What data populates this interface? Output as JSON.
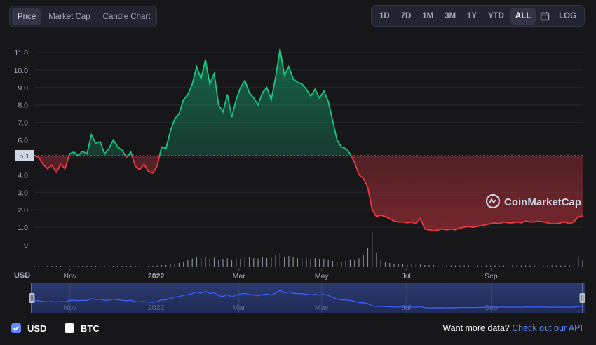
{
  "tabs": [
    {
      "label": "Price",
      "active": true
    },
    {
      "label": "Market Cap",
      "active": false
    },
    {
      "label": "Candle Chart",
      "active": false
    }
  ],
  "ranges": [
    {
      "label": "1D",
      "active": false
    },
    {
      "label": "7D",
      "active": false
    },
    {
      "label": "1M",
      "active": false
    },
    {
      "label": "3M",
      "active": false
    },
    {
      "label": "1Y",
      "active": false
    },
    {
      "label": "YTD",
      "active": false
    },
    {
      "label": "ALL",
      "active": true
    }
  ],
  "log_label": "LOG",
  "currency_label": "USD",
  "brand": "CoinMarketCap",
  "footer": {
    "usd_label": "USD",
    "btc_label": "BTC",
    "usd_checked": true,
    "btc_checked": false,
    "prompt": "Want more data?",
    "link": "Check out our API"
  },
  "colors": {
    "up": "#16c784",
    "down": "#ea3943",
    "accent": "#6188ff",
    "navigator_line": "#3861fb"
  },
  "chart_data": {
    "type": "line",
    "baseline_value": 5.1,
    "baseline_label": "5.1",
    "y_ticks": [
      "11.0",
      "10.0",
      "9.0",
      "8.0",
      "7.0",
      "6.0",
      "5.0",
      "4.0",
      "3.0",
      "2.0",
      "1.0",
      "0"
    ],
    "y_tick_values": [
      11,
      10,
      9,
      8,
      7,
      6,
      5,
      4,
      3,
      2,
      1,
      0
    ],
    "ylim": [
      0,
      11.6
    ],
    "x_ticks": [
      {
        "label": "Nov",
        "t": 0.065
      },
      {
        "label": "2022",
        "t": 0.222
      },
      {
        "label": "Mar",
        "t": 0.373
      },
      {
        "label": "May",
        "t": 0.524
      },
      {
        "label": "Jul",
        "t": 0.678
      },
      {
        "label": "Sep",
        "t": 0.833
      }
    ],
    "series": [
      {
        "values": [
          5.1,
          5.0,
          4.6,
          4.35,
          4.55,
          4.15,
          4.6,
          4.35,
          5.2,
          5.3,
          5.1,
          5.35,
          5.2,
          6.3,
          5.8,
          5.9,
          5.2,
          5.5,
          6.0,
          5.6,
          5.4,
          5.0,
          5.3,
          4.5,
          4.3,
          4.6,
          4.2,
          4.1,
          4.5,
          5.6,
          5.5,
          6.5,
          7.2,
          7.5,
          8.3,
          8.6,
          9.2,
          10.2,
          9.5,
          10.6,
          9.2,
          9.8,
          8.0,
          7.6,
          8.6,
          7.3,
          8.3,
          9.0,
          9.4,
          8.7,
          8.4,
          8.0,
          8.7,
          9.0,
          8.3,
          9.6,
          11.2,
          9.7,
          10.2,
          9.5,
          9.3,
          9.2,
          8.9,
          8.5,
          8.9,
          8.4,
          8.8,
          8.2,
          7.1,
          6.0,
          5.6,
          5.5,
          5.2,
          4.7,
          4.0,
          3.8,
          3.3,
          2.0,
          1.6,
          1.7,
          1.6,
          1.5,
          1.35,
          1.3,
          1.3,
          1.25,
          1.3,
          1.2,
          1.5,
          0.9,
          0.85,
          0.8,
          0.85,
          0.9,
          0.85,
          0.9,
          0.85,
          0.95,
          1.0,
          1.05,
          1.0,
          1.05,
          1.1,
          1.15,
          1.2,
          1.25,
          1.2,
          1.3,
          1.25,
          1.25,
          1.3,
          1.25,
          1.35,
          1.3,
          1.3,
          1.35,
          1.3,
          1.25,
          1.2,
          1.2,
          1.25,
          1.3,
          1.2,
          1.3,
          1.6,
          1.65
        ]
      }
    ],
    "volume": [
      0.02,
      0.02,
      0.02,
      0.03,
      0.02,
      0.02,
      0.02,
      0.02,
      0.02,
      0.03,
      0.03,
      0.03,
      0.03,
      0.04,
      0.04,
      0.04,
      0.03,
      0.03,
      0.04,
      0.03,
      0.03,
      0.03,
      0.03,
      0.03,
      0.03,
      0.04,
      0.04,
      0.04,
      0.05,
      0.06,
      0.06,
      0.08,
      0.1,
      0.12,
      0.15,
      0.2,
      0.25,
      0.3,
      0.26,
      0.3,
      0.22,
      0.27,
      0.2,
      0.22,
      0.25,
      0.2,
      0.22,
      0.25,
      0.3,
      0.28,
      0.26,
      0.25,
      0.28,
      0.26,
      0.3,
      0.35,
      0.4,
      0.3,
      0.32,
      0.3,
      0.26,
      0.28,
      0.25,
      0.22,
      0.26,
      0.22,
      0.24,
      0.2,
      0.18,
      0.15,
      0.15,
      0.18,
      0.2,
      0.2,
      0.25,
      0.35,
      0.55,
      1.0,
      0.4,
      0.2,
      0.15,
      0.12,
      0.1,
      0.08,
      0.08,
      0.07,
      0.07,
      0.07,
      0.07,
      0.06,
      0.06,
      0.06,
      0.05,
      0.05,
      0.05,
      0.05,
      0.05,
      0.05,
      0.05,
      0.05,
      0.05,
      0.05,
      0.05,
      0.05,
      0.05,
      0.05,
      0.05,
      0.05,
      0.05,
      0.05,
      0.05,
      0.05,
      0.05,
      0.05,
      0.05,
      0.05,
      0.05,
      0.05,
      0.05,
      0.05,
      0.05,
      0.05,
      0.05,
      0.08,
      0.3,
      0.2
    ]
  }
}
